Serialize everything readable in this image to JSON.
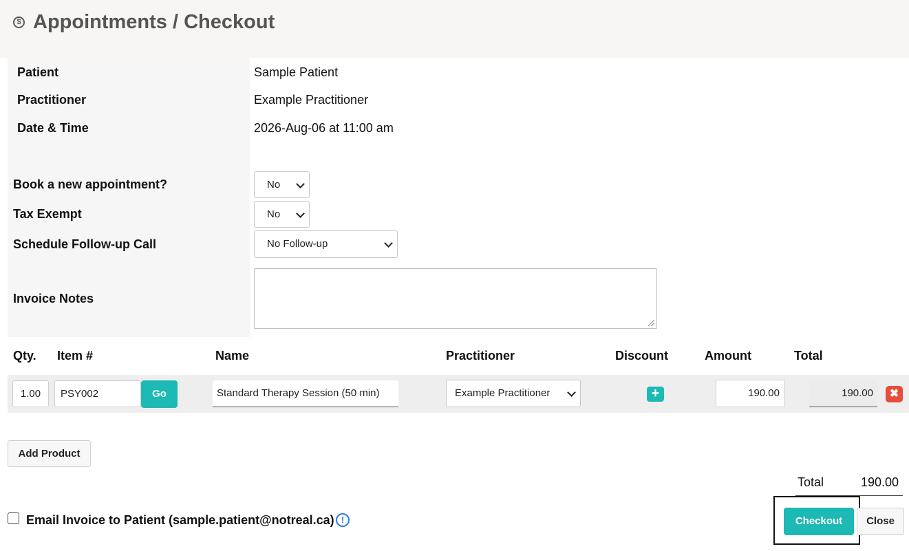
{
  "header": {
    "title": "Appointments / Checkout",
    "icon": "dollar-circle-icon",
    "icon_glyph": "$"
  },
  "details": {
    "patient_label": "Patient",
    "patient_value": "Sample Patient",
    "practitioner_label": "Practitioner",
    "practitioner_value": "Example Practitioner",
    "datetime_label": "Date & Time",
    "datetime_value": "2026-Aug-06 at 11:00 am"
  },
  "form": {
    "book_new_label": "Book a new appointment?",
    "book_new_value": "No",
    "tax_exempt_label": "Tax Exempt",
    "tax_exempt_value": "No",
    "follow_up_label": "Schedule Follow-up Call",
    "follow_up_value": "No Follow-up",
    "notes_label": "Invoice Notes",
    "notes_value": ""
  },
  "table": {
    "headers": {
      "qty": "Qty.",
      "item": "Item #",
      "name": "Name",
      "practitioner": "Practitioner",
      "discount": "Discount",
      "amount": "Amount",
      "total": "Total"
    },
    "row": {
      "qty": "1.00",
      "item": "PSY002",
      "go_label": "Go",
      "name": "Standard Therapy Session (50 min)",
      "practitioner": "Example Practitioner",
      "add_discount_glyph": "+",
      "amount": "190.00",
      "total": "190.00",
      "remove_glyph": "✖"
    }
  },
  "actions": {
    "add_product_label": "Add Product",
    "total_label": "Total",
    "total_value": "190.00",
    "email_label": "Email Invoice to Patient (sample.patient@notreal.ca)",
    "info_glyph": "!",
    "checkout_label": "Checkout",
    "close_label": "Close"
  },
  "colors": {
    "accent": "#1cb9b5",
    "danger": "#e74c3c",
    "info": "#2a7de1",
    "header_bg": "#f7f6f4"
  }
}
